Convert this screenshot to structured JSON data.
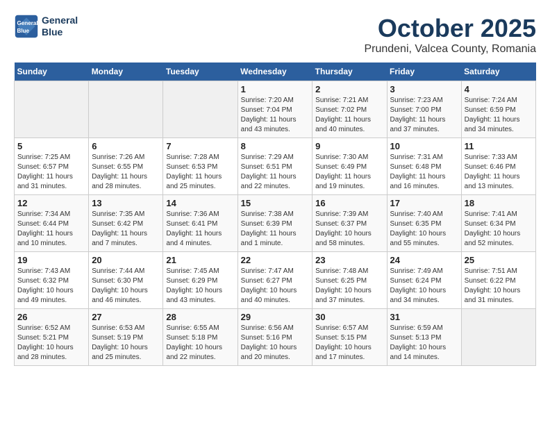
{
  "header": {
    "logo_line1": "General",
    "logo_line2": "Blue",
    "month": "October 2025",
    "location": "Prundeni, Valcea County, Romania"
  },
  "weekdays": [
    "Sunday",
    "Monday",
    "Tuesday",
    "Wednesday",
    "Thursday",
    "Friday",
    "Saturday"
  ],
  "weeks": [
    [
      {
        "day": "",
        "info": ""
      },
      {
        "day": "",
        "info": ""
      },
      {
        "day": "",
        "info": ""
      },
      {
        "day": "1",
        "info": "Sunrise: 7:20 AM\nSunset: 7:04 PM\nDaylight: 11 hours and 43 minutes."
      },
      {
        "day": "2",
        "info": "Sunrise: 7:21 AM\nSunset: 7:02 PM\nDaylight: 11 hours and 40 minutes."
      },
      {
        "day": "3",
        "info": "Sunrise: 7:23 AM\nSunset: 7:00 PM\nDaylight: 11 hours and 37 minutes."
      },
      {
        "day": "4",
        "info": "Sunrise: 7:24 AM\nSunset: 6:59 PM\nDaylight: 11 hours and 34 minutes."
      }
    ],
    [
      {
        "day": "5",
        "info": "Sunrise: 7:25 AM\nSunset: 6:57 PM\nDaylight: 11 hours and 31 minutes."
      },
      {
        "day": "6",
        "info": "Sunrise: 7:26 AM\nSunset: 6:55 PM\nDaylight: 11 hours and 28 minutes."
      },
      {
        "day": "7",
        "info": "Sunrise: 7:28 AM\nSunset: 6:53 PM\nDaylight: 11 hours and 25 minutes."
      },
      {
        "day": "8",
        "info": "Sunrise: 7:29 AM\nSunset: 6:51 PM\nDaylight: 11 hours and 22 minutes."
      },
      {
        "day": "9",
        "info": "Sunrise: 7:30 AM\nSunset: 6:49 PM\nDaylight: 11 hours and 19 minutes."
      },
      {
        "day": "10",
        "info": "Sunrise: 7:31 AM\nSunset: 6:48 PM\nDaylight: 11 hours and 16 minutes."
      },
      {
        "day": "11",
        "info": "Sunrise: 7:33 AM\nSunset: 6:46 PM\nDaylight: 11 hours and 13 minutes."
      }
    ],
    [
      {
        "day": "12",
        "info": "Sunrise: 7:34 AM\nSunset: 6:44 PM\nDaylight: 11 hours and 10 minutes."
      },
      {
        "day": "13",
        "info": "Sunrise: 7:35 AM\nSunset: 6:42 PM\nDaylight: 11 hours and 7 minutes."
      },
      {
        "day": "14",
        "info": "Sunrise: 7:36 AM\nSunset: 6:41 PM\nDaylight: 11 hours and 4 minutes."
      },
      {
        "day": "15",
        "info": "Sunrise: 7:38 AM\nSunset: 6:39 PM\nDaylight: 11 hours and 1 minute."
      },
      {
        "day": "16",
        "info": "Sunrise: 7:39 AM\nSunset: 6:37 PM\nDaylight: 10 hours and 58 minutes."
      },
      {
        "day": "17",
        "info": "Sunrise: 7:40 AM\nSunset: 6:35 PM\nDaylight: 10 hours and 55 minutes."
      },
      {
        "day": "18",
        "info": "Sunrise: 7:41 AM\nSunset: 6:34 PM\nDaylight: 10 hours and 52 minutes."
      }
    ],
    [
      {
        "day": "19",
        "info": "Sunrise: 7:43 AM\nSunset: 6:32 PM\nDaylight: 10 hours and 49 minutes."
      },
      {
        "day": "20",
        "info": "Sunrise: 7:44 AM\nSunset: 6:30 PM\nDaylight: 10 hours and 46 minutes."
      },
      {
        "day": "21",
        "info": "Sunrise: 7:45 AM\nSunset: 6:29 PM\nDaylight: 10 hours and 43 minutes."
      },
      {
        "day": "22",
        "info": "Sunrise: 7:47 AM\nSunset: 6:27 PM\nDaylight: 10 hours and 40 minutes."
      },
      {
        "day": "23",
        "info": "Sunrise: 7:48 AM\nSunset: 6:25 PM\nDaylight: 10 hours and 37 minutes."
      },
      {
        "day": "24",
        "info": "Sunrise: 7:49 AM\nSunset: 6:24 PM\nDaylight: 10 hours and 34 minutes."
      },
      {
        "day": "25",
        "info": "Sunrise: 7:51 AM\nSunset: 6:22 PM\nDaylight: 10 hours and 31 minutes."
      }
    ],
    [
      {
        "day": "26",
        "info": "Sunrise: 6:52 AM\nSunset: 5:21 PM\nDaylight: 10 hours and 28 minutes."
      },
      {
        "day": "27",
        "info": "Sunrise: 6:53 AM\nSunset: 5:19 PM\nDaylight: 10 hours and 25 minutes."
      },
      {
        "day": "28",
        "info": "Sunrise: 6:55 AM\nSunset: 5:18 PM\nDaylight: 10 hours and 22 minutes."
      },
      {
        "day": "29",
        "info": "Sunrise: 6:56 AM\nSunset: 5:16 PM\nDaylight: 10 hours and 20 minutes."
      },
      {
        "day": "30",
        "info": "Sunrise: 6:57 AM\nSunset: 5:15 PM\nDaylight: 10 hours and 17 minutes."
      },
      {
        "day": "31",
        "info": "Sunrise: 6:59 AM\nSunset: 5:13 PM\nDaylight: 10 hours and 14 minutes."
      },
      {
        "day": "",
        "info": ""
      }
    ]
  ]
}
